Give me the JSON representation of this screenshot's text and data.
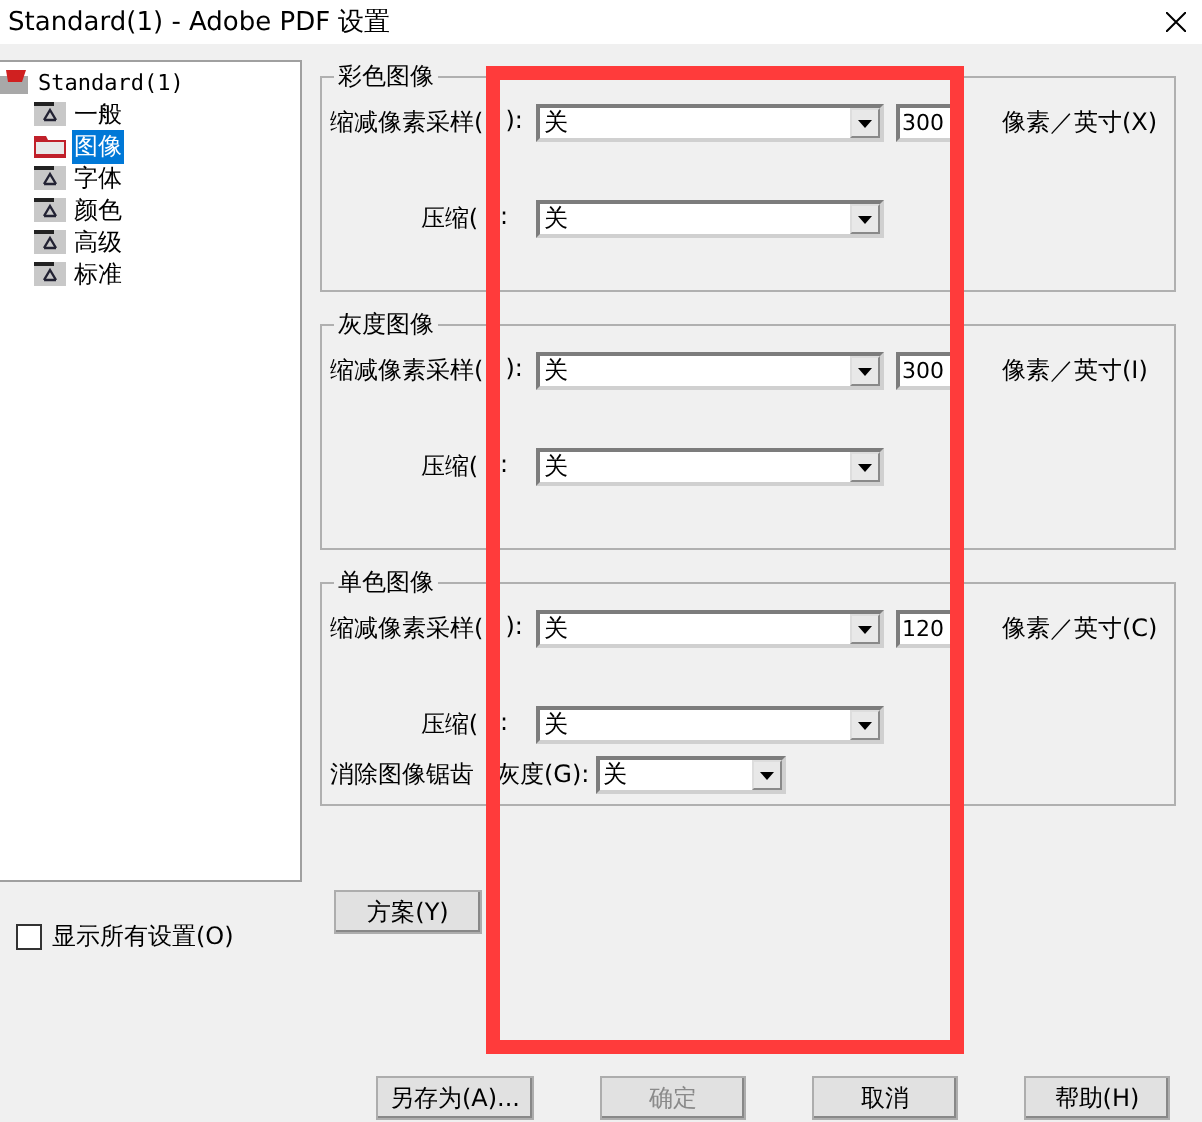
{
  "window": {
    "title": "Standard(1) - Adobe PDF 设置"
  },
  "tree": {
    "root": "Standard(1)",
    "children": [
      {
        "label": "一般",
        "selected": false
      },
      {
        "label": "图像",
        "selected": true
      },
      {
        "label": "字体",
        "selected": false
      },
      {
        "label": "颜色",
        "selected": false
      },
      {
        "label": "高级",
        "selected": false
      },
      {
        "label": "标准",
        "selected": false
      }
    ]
  },
  "groups": [
    {
      "title": "彩色图像",
      "rows": [
        {
          "kind": "sampling",
          "label": "缩减像素采样(",
          "label_tail": "):",
          "value": "关",
          "resolution": "300",
          "unit": "像素／英寸(X)"
        },
        {
          "kind": "compression",
          "label": "压缩(",
          "label_tail": ":",
          "value": "关"
        }
      ]
    },
    {
      "title": "灰度图像",
      "rows": [
        {
          "kind": "sampling",
          "label": "缩减像素采样(",
          "label_tail": "):",
          "value": "关",
          "resolution": "300",
          "unit": "像素／英寸(I)"
        },
        {
          "kind": "compression",
          "label": "压缩(",
          "label_tail": ":",
          "value": "关"
        }
      ]
    },
    {
      "title": "单色图像",
      "rows": [
        {
          "kind": "sampling",
          "label": "缩减像素采样(",
          "label_tail": "):",
          "value": "关",
          "resolution": "120",
          "unit": "像素／英寸(C)"
        },
        {
          "kind": "compression",
          "label": "压缩(",
          "label_tail": ":",
          "value": "关"
        },
        {
          "kind": "antialias",
          "label": "消除图像锯齿",
          "label_tail": "灰度(G):",
          "value": "关"
        }
      ]
    }
  ],
  "scheme_button": "方案(Y)",
  "show_all": {
    "label": "显示所有设置(O)",
    "checked": false
  },
  "buttons": [
    {
      "label": "另存为(A)...",
      "disabled": false
    },
    {
      "label": "确定",
      "disabled": true
    },
    {
      "label": "取消",
      "disabled": false
    },
    {
      "label": "帮助(H)",
      "disabled": false
    }
  ],
  "annotation": {
    "kind": "frame"
  }
}
